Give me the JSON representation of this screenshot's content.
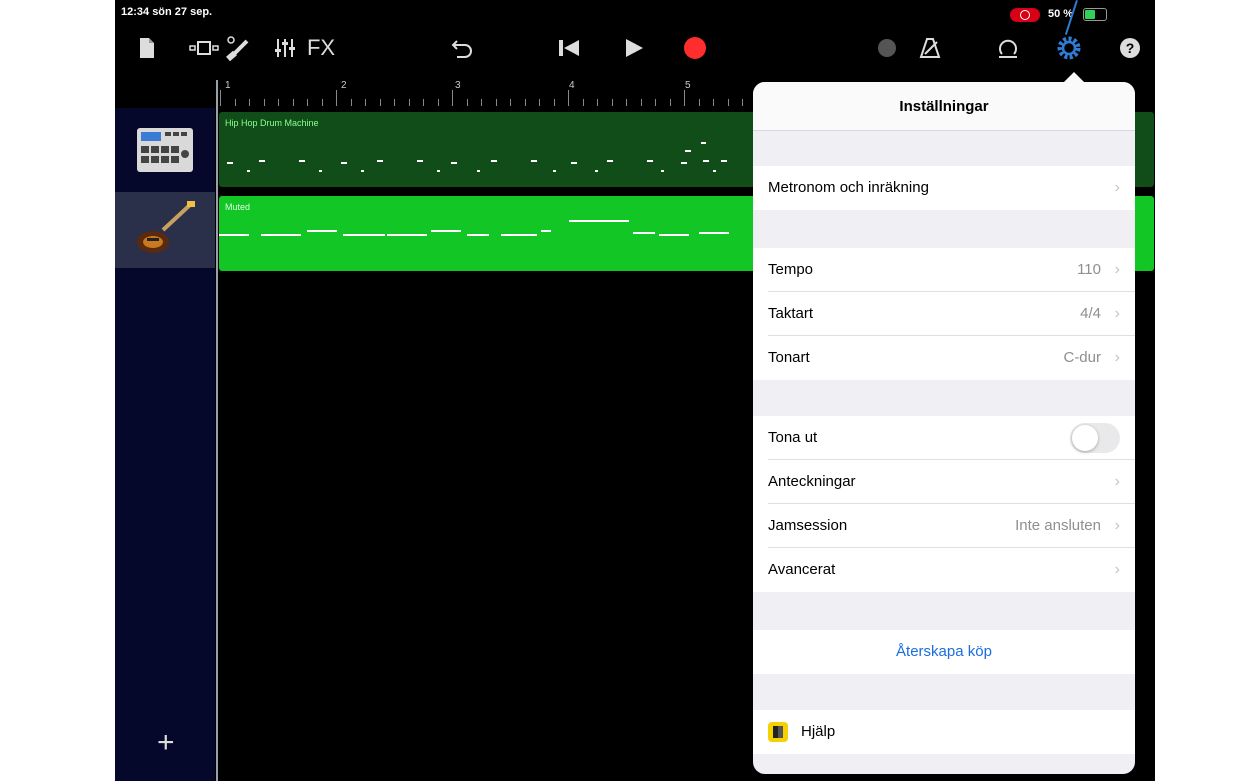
{
  "status": {
    "time": "12:34  sön 27 sep.",
    "battery_text": "50 %",
    "battery_level": 0.5,
    "record_color": "#d70015"
  },
  "toolbar": {
    "icons": [
      "document-icon",
      "track-view-icon",
      "smart-controls-icon",
      "mixer-icon",
      "fx-label",
      "undo-icon",
      "go-to-start-icon",
      "play-icon",
      "record-icon",
      "circle-icon",
      "metronome-icon",
      "loop-icon",
      "settings-gear-icon",
      "help-icon"
    ],
    "fx_label": "FX",
    "accent": "#ff2d2d",
    "settings_color": "#2f7cd6"
  },
  "ruler": {
    "bars": [
      "1",
      "2",
      "3",
      "4",
      "5"
    ]
  },
  "tracks": [
    {
      "name": "Hip Hop Drum Machine",
      "icon": "drum-machine-icon",
      "color": "#114d18"
    },
    {
      "name": "Muted",
      "icon": "bass-guitar-icon",
      "color": "#12c625"
    }
  ],
  "settings": {
    "title": "Inställningar",
    "metronome": "Metronom och inräkning",
    "tempo_label": "Tempo",
    "tempo_value": "110",
    "time_sig_label": "Taktart",
    "time_sig_value": "4/4",
    "key_label": "Tonart",
    "key_value": "C-dur",
    "fade_out_label": "Tona ut",
    "fade_out_on": false,
    "notes_label": "Anteckningar",
    "jam_label": "Jamsession",
    "jam_value": "Inte ansluten",
    "advanced_label": "Avancerat",
    "restore_label": "Återskapa köp",
    "help_label": "Hjälp",
    "link_color": "#1a6ee0"
  }
}
